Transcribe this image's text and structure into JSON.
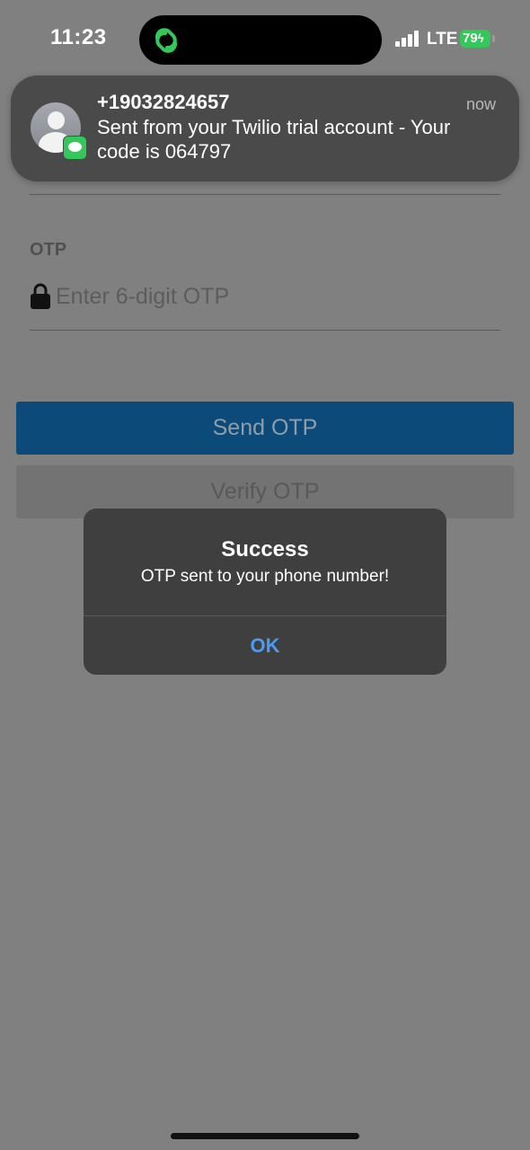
{
  "status_bar": {
    "time": "11:23",
    "network": "LTE",
    "battery": "79",
    "battery_color": "#34c759"
  },
  "dynamic_island": {
    "icon": "linked-rings-icon",
    "icon_color": "#34c759"
  },
  "notification": {
    "sender": "+19032824657",
    "time": "now",
    "body": "Sent from your Twilio trial account - Your code is 064797",
    "icon": "messages-icon"
  },
  "form": {
    "otp_label": "OTP",
    "otp_placeholder": "Enter 6-digit OTP",
    "otp_value": "",
    "lock_icon": "lock-icon"
  },
  "buttons": {
    "send": "Send OTP",
    "verify": "Verify OTP",
    "send_color": "#0c4a7a"
  },
  "alert": {
    "title": "Success",
    "message": "OTP sent to your phone number!",
    "ok": "OK",
    "ok_color": "#4a9bf2"
  }
}
